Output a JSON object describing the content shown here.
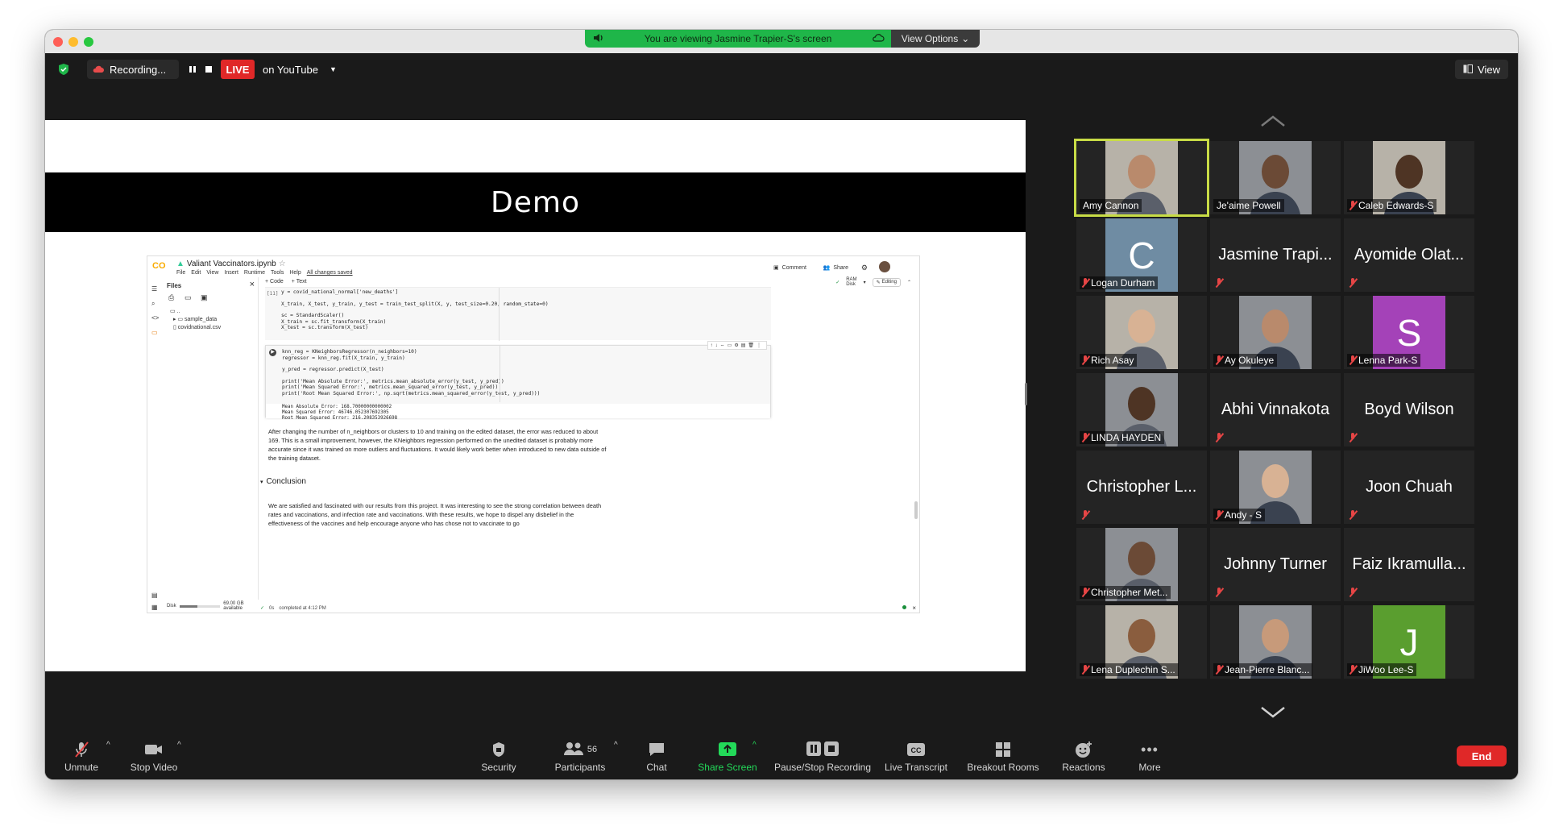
{
  "banner": {
    "text": "You are viewing Jasmine Trapier-S's screen",
    "view_options": "View Options"
  },
  "topbar": {
    "recording": "Recording...",
    "live": "LIVE",
    "live_target": "on YouTube",
    "view": "View"
  },
  "slide": {
    "title": "Demo",
    "colab": {
      "notebook": "Valiant Vaccinators.ipynb",
      "menu": [
        "File",
        "Edit",
        "View",
        "Insert",
        "Runtime",
        "Tools",
        "Help",
        "All changes saved"
      ],
      "comment": "Comment",
      "share": "Share",
      "files_title": "Files",
      "add_code": "+ Code",
      "add_text": "+ Text",
      "ram": "RAM",
      "disk": "Disk",
      "editing": "Editing",
      "tree": [
        "..",
        "sample_data",
        "covidnational.csv"
      ],
      "cell_no": "[11]",
      "code1": [
        "y = covid_national_normal['new_deaths']",
        "",
        "X_train, X_test, y_train, y_test = train_test_split(X, y, test_size=0.20, random_state=0)",
        "",
        "sc = StandardScaler()",
        "X_train = sc.fit_transform(X_train)",
        "X_test = sc.transform(X_test)"
      ],
      "code2": [
        "knn_reg = KNeighborsRegressor(n_neighbors=10)",
        "regressor = knn_reg.fit(X_train, y_train)",
        "",
        "y_pred = regressor.predict(X_test)",
        "",
        "print('Mean Absolute Error:', metrics.mean_absolute_error(y_test, y_pred))",
        "print('Mean Squared Error:', metrics.mean_squared_error(y_test, y_pred))",
        "print('Root Mean Squared Error:', np.sqrt(metrics.mean_squared_error(y_test, y_pred)))"
      ],
      "output": [
        "Mean Absolute Error: 168.70000000000002",
        "Mean Squared Error: 46746.052307692305",
        "Root Mean Squared Error: 216.208353926698"
      ],
      "paragraph1": "After changing the number of n_neighbors or clusters to 10 and training on the edited dataset, the error was reduced to about 169. This is a small improvement, however, the KNeighbors regression performed on the unedited dataset is probably more accurate since it was trained on more outliers and fluctuations. It would likely work better when introduced to new data outside of the training dataset.",
      "conclusion_heading": "Conclusion",
      "paragraph2": "We are satisfied and fascinated with our results from this project. It was interesting to see the strong correlation between death rates and vaccinations, and infection rate and vaccinations. With these results, we hope to dispel any disbelief in the effectiveness of the vaccines and help encourage anyone who has chose not to vaccinate to go",
      "disk_status": "69.00 GB available",
      "disk_label": "Disk",
      "status_time": "0s",
      "status": "completed at 4:12 PM"
    }
  },
  "participants": [
    {
      "name": "Amy Cannon",
      "kind": "photo",
      "active": true
    },
    {
      "name": "Je'aime Powell",
      "kind": "photo"
    },
    {
      "name": "Caleb Edwards-S",
      "kind": "photo"
    },
    {
      "name": "Logan Durham",
      "kind": "avatar",
      "letter": "C",
      "color": "#6f8ca3"
    },
    {
      "name": "Jasmine Trapi...",
      "kind": "text"
    },
    {
      "name": "Ayomide Olat...",
      "kind": "text"
    },
    {
      "name": "Rich Asay",
      "kind": "photo"
    },
    {
      "name": "Ay Okuleye",
      "kind": "photo"
    },
    {
      "name": "Lenna Park-S",
      "kind": "avatar",
      "letter": "S",
      "color": "#a442b8"
    },
    {
      "name": "LINDA HAYDEN",
      "kind": "photo"
    },
    {
      "name": "Abhi Vinnakota",
      "kind": "text"
    },
    {
      "name": "Boyd Wilson",
      "kind": "text"
    },
    {
      "name": "Christopher L...",
      "kind": "text"
    },
    {
      "name": "Andy - S",
      "kind": "photo"
    },
    {
      "name": "Joon Chuah",
      "kind": "text"
    },
    {
      "name": "Christopher Met...",
      "kind": "photo"
    },
    {
      "name": "Johnny Turner",
      "kind": "text"
    },
    {
      "name": "Faiz Ikramulla...",
      "kind": "text"
    },
    {
      "name": "Lena Duplechin S...",
      "kind": "photo"
    },
    {
      "name": "Jean-Pierre Blanc...",
      "kind": "photo"
    },
    {
      "name": "JiWoo Lee-S",
      "kind": "avatar",
      "letter": "J",
      "color": "#5a9e2f"
    }
  ],
  "toolbar": {
    "unmute": "Unmute",
    "stop_video": "Stop Video",
    "security": "Security",
    "participants": "Participants",
    "participant_count": "56",
    "chat": "Chat",
    "share_screen": "Share Screen",
    "pause_stop": "Pause/Stop Recording",
    "live_transcript": "Live Transcript",
    "breakout_rooms": "Breakout Rooms",
    "reactions": "Reactions",
    "more": "More",
    "end": "End",
    "accent_green": "#23d959",
    "end_red": "#e02828"
  }
}
